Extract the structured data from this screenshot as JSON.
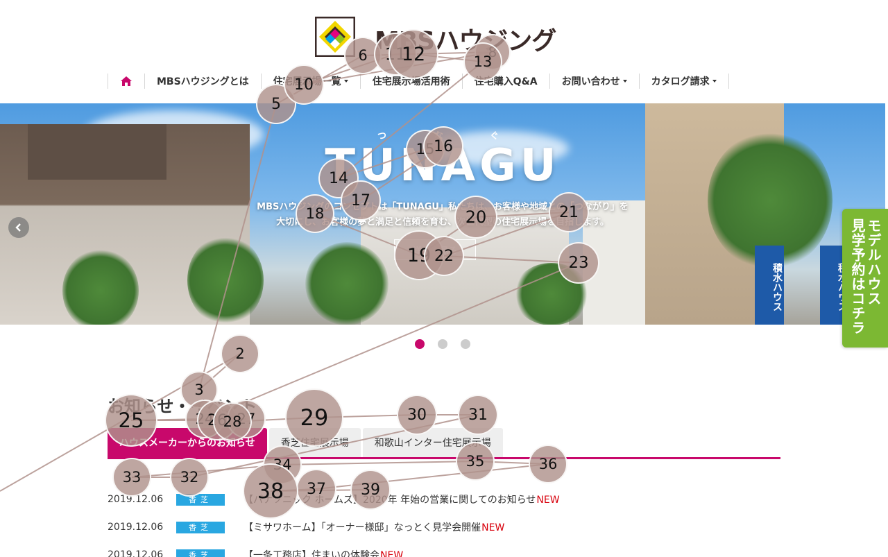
{
  "header": {
    "logo_text": "MBSハウジング",
    "nav": [
      {
        "label": "",
        "icon": "home-icon"
      },
      {
        "label": "MBSハウジングとは",
        "dropdown": false
      },
      {
        "label": "住宅展示場一覧",
        "dropdown": true
      },
      {
        "label": "住宅展示場活用術",
        "dropdown": false
      },
      {
        "label": "住宅購入Q&A",
        "dropdown": false
      },
      {
        "label": "お問い合わせ",
        "dropdown": true
      },
      {
        "label": "カタログ請求",
        "dropdown": true
      }
    ]
  },
  "hero": {
    "ruby": [
      "つ",
      "な",
      "ぐ"
    ],
    "title": "TUNAGU",
    "subtitle_line1": "MBSハウジングのコンセプトは「TUNAGU」私たちは、お客様や地域との「つながり」を",
    "subtitle_line2": "大切にし、お客様の夢と満足と信頼を育む、次世代型の住宅展示場を目指します。",
    "button_label": "詳しく見る",
    "sign_label": "積水ハウス",
    "slide_count": 3,
    "active_slide": 1
  },
  "side_tab": {
    "line1": "モデルハウス",
    "line2": "見学予約はコチラ"
  },
  "news": {
    "title": "お知らせ・イベント",
    "tabs": [
      "ハウスメーカーからのお知らせ",
      "香芝住宅展示場",
      "和歌山インター住宅展示場"
    ],
    "active_tab": 0,
    "items": [
      {
        "date": "2019.12.06",
        "badge": "香芝",
        "text": "【パナソニック ホームズ】2020年 年始の営業に関してのお知らせ",
        "new": "NEW"
      },
      {
        "date": "2019.12.06",
        "badge": "香芝",
        "text": "【ミサワホーム】「オーナー様邸」なっとく見学会開催",
        "new": "NEW"
      },
      {
        "date": "2019.12.06",
        "badge": "香芝",
        "text": "【一条工務店】住まいの体験会",
        "new": "NEW"
      }
    ]
  },
  "colors": {
    "accent": "#c8086b",
    "badge": "#29a7e1",
    "side_tab": "#7cb833",
    "new": "#d8000c"
  },
  "markers": [
    {
      "n": "2"
    },
    {
      "n": "3"
    },
    {
      "n": "5"
    },
    {
      "n": "6"
    },
    {
      "n": "8"
    },
    {
      "n": "10"
    },
    {
      "n": "11"
    },
    {
      "n": "12"
    },
    {
      "n": "13"
    },
    {
      "n": "14"
    },
    {
      "n": "15"
    },
    {
      "n": "16"
    },
    {
      "n": "17"
    },
    {
      "n": "18"
    },
    {
      "n": "19"
    },
    {
      "n": "20"
    },
    {
      "n": "21"
    },
    {
      "n": "22"
    },
    {
      "n": "23"
    },
    {
      "n": "24"
    },
    {
      "n": "25"
    },
    {
      "n": "26"
    },
    {
      "n": "27"
    },
    {
      "n": "28"
    },
    {
      "n": "29"
    },
    {
      "n": "30"
    },
    {
      "n": "31"
    },
    {
      "n": "32"
    },
    {
      "n": "33"
    },
    {
      "n": "34"
    },
    {
      "n": "35"
    },
    {
      "n": "36"
    },
    {
      "n": "37"
    },
    {
      "n": "38"
    },
    {
      "n": "39"
    }
  ]
}
